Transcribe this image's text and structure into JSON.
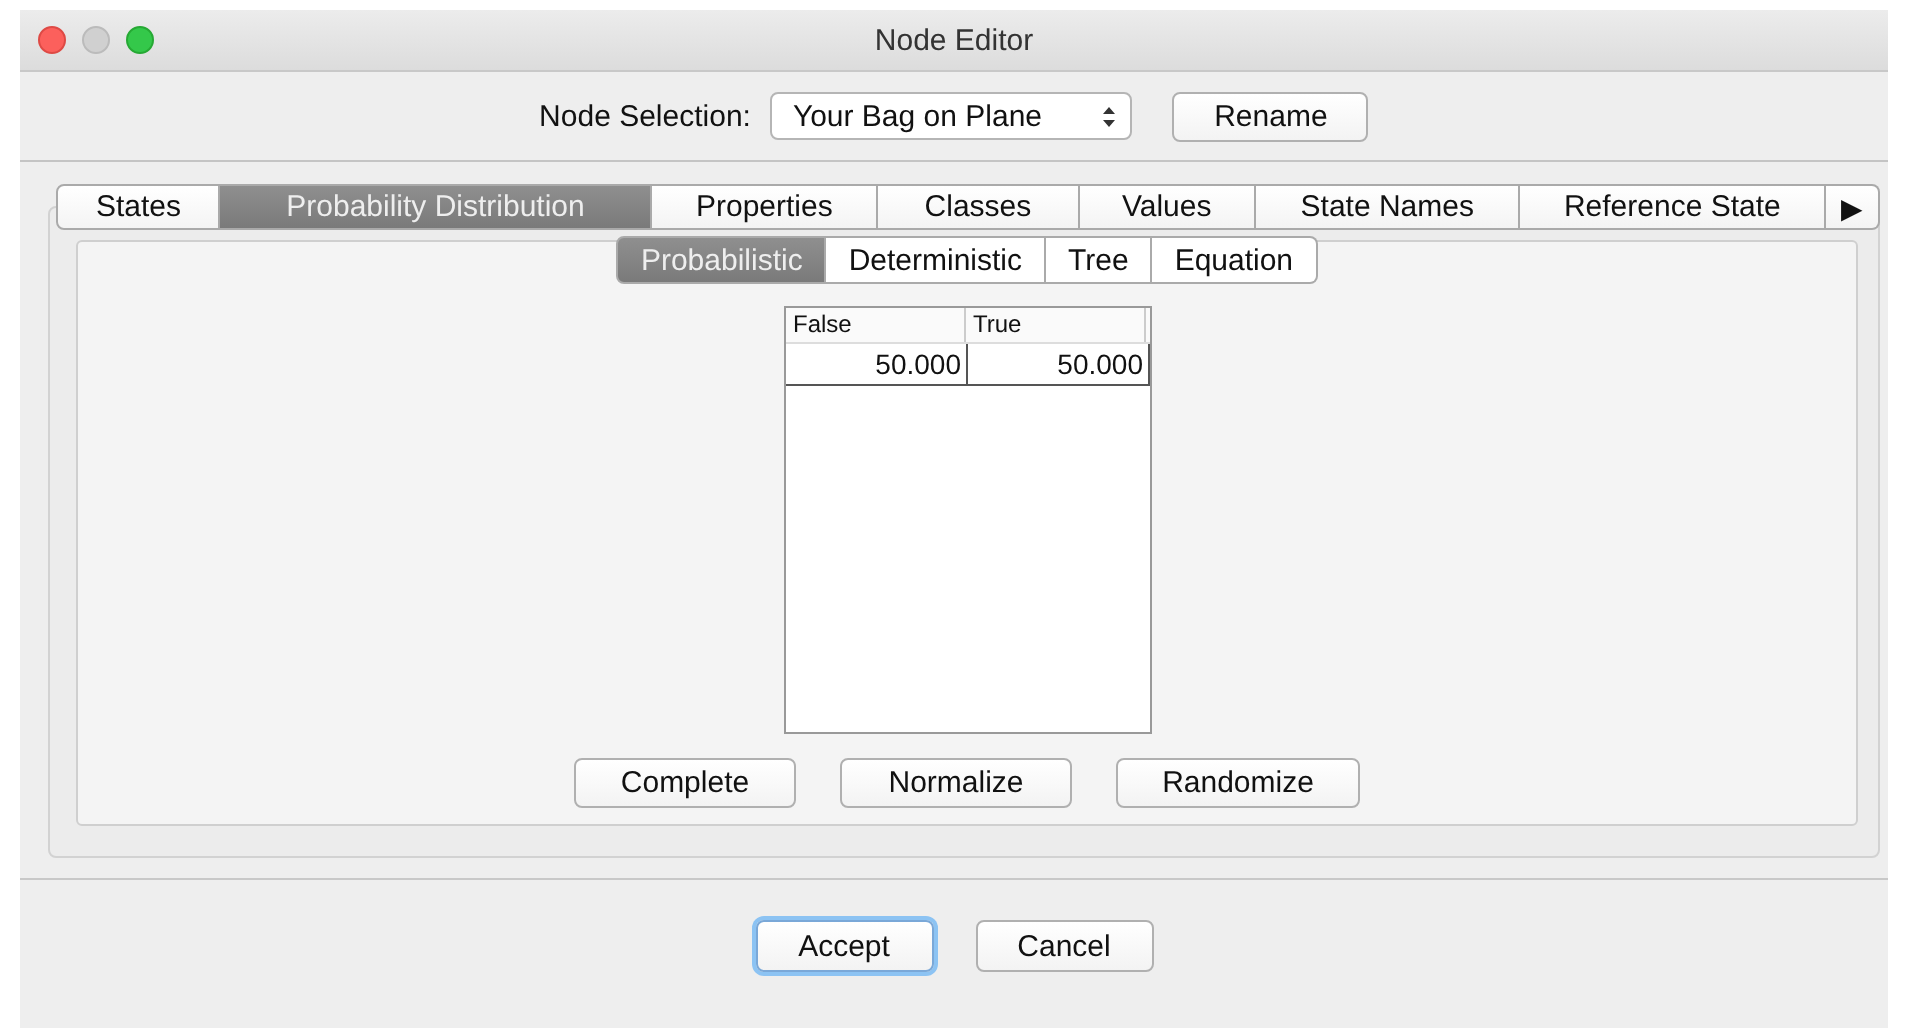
{
  "window": {
    "title": "Node Editor"
  },
  "node_selection": {
    "label": "Node Selection:",
    "value": "Your Bag on Plane",
    "button": "Rename"
  },
  "tabs": [
    {
      "label": "States",
      "selected": false
    },
    {
      "label": "Probability Distribution",
      "selected": true
    },
    {
      "label": "Properties",
      "selected": false
    },
    {
      "label": "Classes",
      "selected": false
    },
    {
      "label": "Values",
      "selected": false
    },
    {
      "label": "State Names",
      "selected": false
    },
    {
      "label": "Reference State",
      "selected": false
    }
  ],
  "tab_scroll": "▶",
  "subtabs": [
    {
      "label": "Probabilistic",
      "selected": true
    },
    {
      "label": "Deterministic",
      "selected": false
    },
    {
      "label": "Tree",
      "selected": false
    },
    {
      "label": "Equation",
      "selected": false
    }
  ],
  "table": {
    "columns": [
      "False",
      "True"
    ],
    "rows": [
      [
        "50.000",
        "50.000"
      ]
    ]
  },
  "actions": [
    "Complete",
    "Normalize",
    "Randomize"
  ],
  "footer_buttons": [
    {
      "label": "Accept",
      "focused": true
    },
    {
      "label": "Cancel",
      "focused": false
    }
  ]
}
